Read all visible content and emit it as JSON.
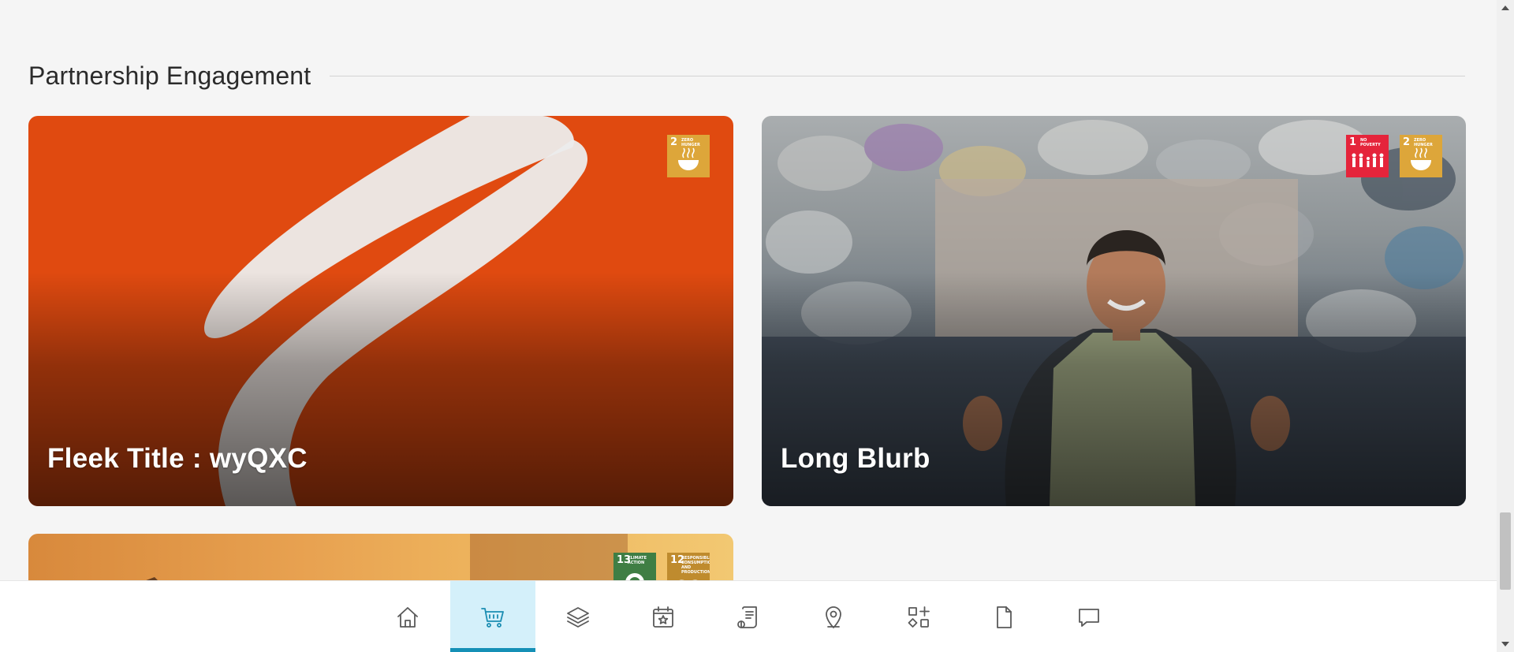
{
  "section": {
    "title": "Partnership Engagement"
  },
  "cards": [
    {
      "title": "Fleek Title : wyQXC",
      "badges": [
        {
          "number": "2",
          "label": "ZERO HUNGER",
          "color": "#DDA63A",
          "icon": "bowl-icon"
        }
      ]
    },
    {
      "title": "Long Blurb",
      "badges": [
        {
          "number": "1",
          "label": "NO POVERTY",
          "color": "#E5243B",
          "icon": "people-icon"
        },
        {
          "number": "2",
          "label": "ZERO HUNGER",
          "color": "#DDA63A",
          "icon": "bowl-icon"
        }
      ]
    },
    {
      "title": "",
      "badges": [
        {
          "number": "13",
          "label": "CLIMATE ACTION",
          "color": "#3F7E44",
          "icon": "globe-icon"
        },
        {
          "number": "12",
          "label": "RESPONSIBLE CONSUMPTION AND PRODUCTION",
          "color": "#BF8B2E",
          "icon": "infinity-icon"
        }
      ]
    }
  ],
  "bottom_nav": {
    "active_index": 1,
    "accent_color": "#1590b6",
    "items": [
      {
        "icon": "home-icon"
      },
      {
        "icon": "cart-icon"
      },
      {
        "icon": "layers-icon"
      },
      {
        "icon": "calendar-star-icon"
      },
      {
        "icon": "document-list-icon"
      },
      {
        "icon": "map-pin-icon"
      },
      {
        "icon": "widgets-icon"
      },
      {
        "icon": "file-icon"
      },
      {
        "icon": "chat-icon"
      }
    ]
  }
}
